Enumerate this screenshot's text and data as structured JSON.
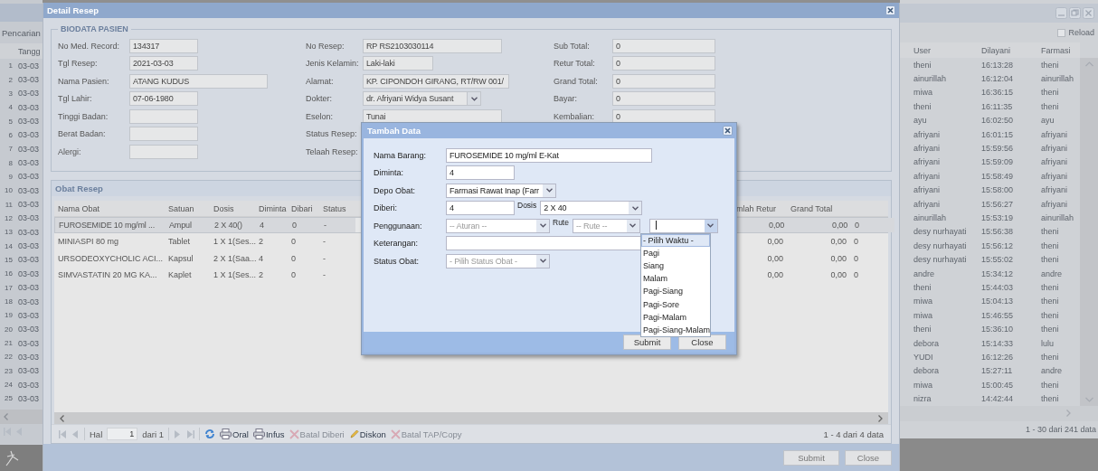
{
  "background_left": {
    "title": "Pencarian",
    "column": "Tangg",
    "rows": [
      {
        "no": "1",
        "date": "03-03"
      },
      {
        "no": "2",
        "date": "03-03"
      },
      {
        "no": "3",
        "date": "03-03"
      },
      {
        "no": "4",
        "date": "03-03"
      },
      {
        "no": "5",
        "date": "03-03"
      },
      {
        "no": "6",
        "date": "03-03"
      },
      {
        "no": "7",
        "date": "03-03"
      },
      {
        "no": "8",
        "date": "03-03"
      },
      {
        "no": "9",
        "date": "03-03"
      },
      {
        "no": "10",
        "date": "03-03"
      },
      {
        "no": "11",
        "date": "03-03"
      },
      {
        "no": "12",
        "date": "03-03"
      },
      {
        "no": "13",
        "date": "03-03"
      },
      {
        "no": "14",
        "date": "03-03"
      },
      {
        "no": "15",
        "date": "03-03"
      },
      {
        "no": "16",
        "date": "03-03"
      },
      {
        "no": "17",
        "date": "03-03"
      },
      {
        "no": "18",
        "date": "03-03"
      },
      {
        "no": "19",
        "date": "03-03"
      },
      {
        "no": "20",
        "date": "03-03"
      },
      {
        "no": "21",
        "date": "03-03"
      },
      {
        "no": "22",
        "date": "03-03"
      },
      {
        "no": "23",
        "date": "03-03"
      },
      {
        "no": "24",
        "date": "03-03"
      },
      {
        "no": "25",
        "date": "03-03"
      }
    ]
  },
  "background_right": {
    "reload": "Reload",
    "columns": [
      "User",
      "Dilayani",
      "Farmasi"
    ],
    "rows": [
      [
        "theni",
        "16:13:28",
        "theni"
      ],
      [
        "ainurillah",
        "16:12:04",
        "ainurillah"
      ],
      [
        "miwa",
        "16:36:15",
        "theni"
      ],
      [
        "theni",
        "16:11:35",
        "theni"
      ],
      [
        "ayu",
        "16:02:50",
        "ayu"
      ],
      [
        "afriyani",
        "16:01:15",
        "afriyani"
      ],
      [
        "afriyani",
        "15:59:56",
        "afriyani"
      ],
      [
        "afriyani",
        "15:59:09",
        "afriyani"
      ],
      [
        "afriyani",
        "15:58:49",
        "afriyani"
      ],
      [
        "afriyani",
        "15:58:00",
        "afriyani"
      ],
      [
        "afriyani",
        "15:56:27",
        "afriyani"
      ],
      [
        "ainurillah",
        "15:53:19",
        "ainurillah"
      ],
      [
        "desy nurhayati",
        "15:56:38",
        "theni"
      ],
      [
        "desy nurhayati",
        "15:56:12",
        "theni"
      ],
      [
        "desy nurhayati",
        "15:55:02",
        "theni"
      ],
      [
        "andre",
        "15:34:12",
        "andre"
      ],
      [
        "theni",
        "15:44:03",
        "theni"
      ],
      [
        "miwa",
        "15:04:13",
        "theni"
      ],
      [
        "miwa",
        "15:46:55",
        "theni"
      ],
      [
        "theni",
        "15:36:10",
        "theni"
      ],
      [
        "debora",
        "15:14:33",
        "lulu"
      ],
      [
        "YUDI",
        "16:12:26",
        "theni"
      ],
      [
        "debora",
        "15:27:11",
        "andre"
      ],
      [
        "miwa",
        "15:00:45",
        "theni"
      ],
      [
        "nizra",
        "14:42:44",
        "theni"
      ]
    ],
    "summary": "1 - 30 dari 241 data"
  },
  "window": {
    "title": "Detail Resep"
  },
  "biodata": {
    "title": "BIODATA PASIEN",
    "columns": [
      [
        {
          "label": "No Med. Record:",
          "kind": "input",
          "value": "134317"
        },
        {
          "label": "Tgl Resep:",
          "kind": "input",
          "value": "2021-03-03"
        },
        {
          "label": "Nama Pasien:",
          "kind": "input",
          "value": "ATANG KUDUS"
        },
        {
          "label": "Tgl Lahir:",
          "kind": "input",
          "value": "07-06-1980"
        },
        {
          "label": "Tinggi Badan:",
          "kind": "input"
        },
        {
          "label": "Berat Badan:",
          "kind": "input"
        },
        {
          "label": "Alergi:",
          "kind": "input"
        }
      ],
      [
        {
          "label": "No Resep:",
          "kind": "input",
          "value": "RP RS2103030114"
        },
        {
          "label": "Jenis Kelamin:",
          "kind": "input",
          "value": "Laki-laki"
        },
        {
          "label": "Alamat:",
          "kind": "input",
          "value": "KP. CIPONDOH GIRANG, RT/RW 001/"
        },
        {
          "label": "Dokter:",
          "kind": "select",
          "value": "dr. Afriyani Widya Susant"
        },
        {
          "label": "Eselon:",
          "kind": "input",
          "value": "Tunai"
        },
        {
          "label": "Status Resep:"
        },
        {
          "label": "Telaah Resep:"
        }
      ],
      [
        {
          "label": "Sub Total:",
          "kind": "input",
          "value": "0"
        },
        {
          "label": "Retur Total:",
          "kind": "input",
          "value": "0"
        },
        {
          "label": "Grand Total:",
          "kind": "input",
          "value": "0"
        },
        {
          "label": "Bayar:",
          "kind": "input",
          "value": "0"
        },
        {
          "label": "Kembalian:",
          "kind": "input",
          "value": "0"
        }
      ]
    ]
  },
  "obat_resep": {
    "title": "Obat Resep",
    "columns": [
      "Nama Obat",
      "Satuan",
      "Dosis",
      "Diminta",
      "Dibari",
      "Status",
      "mlah Retur",
      "Grand Total"
    ],
    "rows": [
      {
        "cells": [
          "FUROSEMIDE 10 mg/ml ...",
          "Ampul",
          "2 X 40()",
          "4",
          "0",
          "-",
          "0,00",
          "0,00",
          "0"
        ],
        "selected": true
      },
      {
        "cells": [
          "MINIASPI 80 mg",
          "Tablet",
          "1 X 1(Ses...",
          "2",
          "0",
          "-",
          "0,00",
          "0,00",
          "0"
        ],
        "selected": false
      },
      {
        "cells": [
          "URSODEOXYCHOLIC ACI...",
          "Kapsul",
          "2 X 1(Saa...",
          "4",
          "0",
          "-",
          "0,00",
          "0,00",
          "0"
        ],
        "selected": false
      },
      {
        "cells": [
          "SIMVASTATIN 20 MG KA...",
          "Kaplet",
          "1 X 1(Ses...",
          "2",
          "0",
          "-",
          "0,00",
          "0,00",
          "0"
        ],
        "selected": false
      }
    ],
    "pager": {
      "page_label": "Hal",
      "page": "1",
      "of": "dari 1",
      "tools": [
        {
          "kind": "refresh",
          "disabled": false
        },
        {
          "kind": "print",
          "label": "Oral",
          "disabled": false
        },
        {
          "kind": "print",
          "label": "Infus",
          "disabled": false
        },
        {
          "kind": "cancel",
          "label": "Batal Diberi",
          "disabled": true
        },
        {
          "kind": "edit",
          "label": "Diskon",
          "disabled": false
        },
        {
          "kind": "cancel",
          "label": "Batal TAP/Copy",
          "disabled": true
        }
      ]
    },
    "summary": "1 - 4 dari 4 data"
  },
  "buttons": [
    "Submit",
    "Close"
  ],
  "dialog": {
    "title": "Tambah Data",
    "rows": [
      {
        "label": "Nama Barang:",
        "controls": [
          {
            "kind": "input",
            "value": "FUROSEMIDE 10 mg/ml E-Kat"
          }
        ]
      },
      {
        "label": "Diminta:",
        "controls": [
          {
            "kind": "input",
            "value": "4"
          }
        ]
      },
      {
        "label": "Depo Obat:",
        "controls": [
          {
            "kind": "select",
            "value": "Farmasi Rawat Inap (Farr"
          }
        ]
      },
      {
        "label": "Diberi:",
        "controls": [
          {
            "kind": "input",
            "value": "4"
          },
          {
            "kind": "label",
            "text": "Dosis"
          },
          {
            "kind": "select",
            "value": "2 X 40"
          }
        ]
      },
      {
        "label": "Penggunaan:",
        "controls": [
          {
            "kind": "select",
            "placeholder": "-- Aturan --"
          },
          {
            "kind": "label",
            "text": "Rute"
          },
          {
            "kind": "select",
            "placeholder": "-- Rute --"
          },
          {
            "kind": "select",
            "expanded": true
          }
        ]
      },
      {
        "label": "Keterangan:",
        "controls": [
          {
            "kind": "input"
          }
        ]
      },
      {
        "label": "Status Obat:",
        "controls": [
          {
            "kind": "select",
            "placeholder": "- Pilih Status Obat -"
          }
        ]
      }
    ],
    "dropdown": [
      {
        "label": "- Pilih Waktu -",
        "selected": true
      },
      {
        "label": "Pagi",
        "selected": false
      },
      {
        "label": "Siang",
        "selected": false
      },
      {
        "label": "Malam",
        "selected": false
      },
      {
        "label": "Pagi-Siang",
        "selected": false
      },
      {
        "label": "Pagi-Sore",
        "selected": false
      },
      {
        "label": "Pagi-Malam",
        "selected": false
      },
      {
        "label": "Pagi-Siang-Malam",
        "selected": false
      }
    ],
    "buttons": [
      "Submit",
      "Close"
    ]
  }
}
